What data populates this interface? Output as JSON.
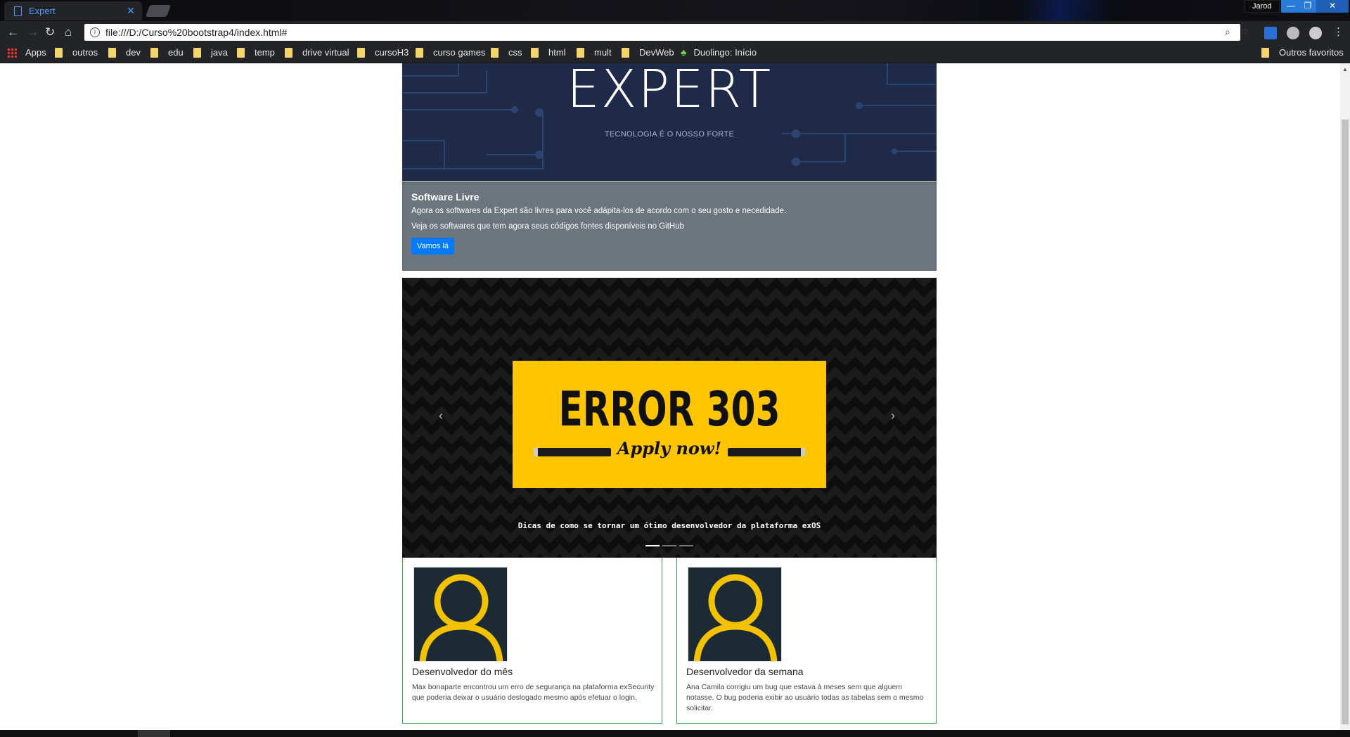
{
  "browser": {
    "tab_title": "Expert",
    "tab_close": "✕",
    "user_name": "Jarod",
    "window_controls": {
      "minimize": "—",
      "maximize": "❐",
      "close": "✕"
    },
    "url": "file:///D:/Curso%20bootstrap4/index.html#",
    "info_icon": "i",
    "bookmarks": [
      {
        "label": "Apps"
      },
      {
        "label": "outros"
      },
      {
        "label": "dev"
      },
      {
        "label": "edu"
      },
      {
        "label": "java"
      },
      {
        "label": "temp"
      },
      {
        "label": "drive virtual"
      },
      {
        "label": "cursoH3"
      },
      {
        "label": "curso games"
      },
      {
        "label": "css"
      },
      {
        "label": "html"
      },
      {
        "label": "mult"
      },
      {
        "label": "DevWeb"
      },
      {
        "label": "Duolingo: Início"
      }
    ],
    "other_bookmarks": "Outros favoritos"
  },
  "banner": {
    "title": "EXPERT",
    "subtitle": "TECNOLOGIA É O NOSSO FORTE"
  },
  "alert": {
    "heading": "Software Livre",
    "text1": "Agora os softwares da Expert são livres para você adápita-los de acordo com o seu gosto e necedidade.",
    "text2": "Veja os softwares que tem agora seus códigos fontes disponíveis no GitHub",
    "button": "Vamos lá"
  },
  "carousel": {
    "slide_title": "ERROR 303",
    "slide_subtitle": "Apply now!",
    "caption": "Dicas de como se tornar um ótimo desenvolvedor da plataforma exOS",
    "prev": "‹",
    "next": "›",
    "slide_count": 3,
    "active_index": 0
  },
  "cards": [
    {
      "title": "Desenvolvedor do mês",
      "text": "Max bonaparte encontrou um erro de segurança na plataforma exSecurity que poderia deixar o usuário deslogado mesmo após efetuar o login."
    },
    {
      "title": "Desenvolvedor da semana",
      "text": "Ana Camila corrigiu um bug que estava à meses sem que alguem notasse. O bug poderia exibir ao usuário todas as tabelas sem o mesmo solicitar."
    }
  ],
  "colors": {
    "banner_bg": "#1e2a48",
    "alert_bg": "#6c757d",
    "primary": "#007bff",
    "slide_yellow": "#ffc600",
    "card_border": "#28a745",
    "avatar_ring": "#f2c200"
  }
}
